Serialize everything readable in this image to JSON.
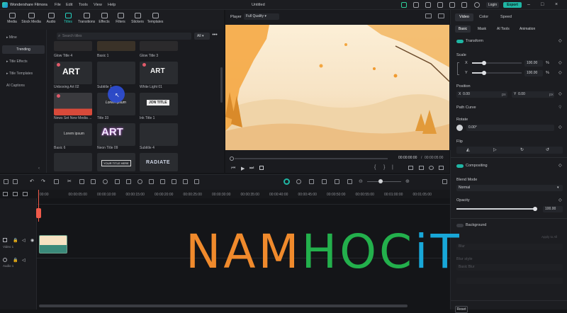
{
  "app": {
    "name": "Wondershare Filmora",
    "doc_title": "Untitled",
    "menu": [
      "File",
      "Edit",
      "Tools",
      "View",
      "Help"
    ],
    "login": "Login",
    "export": "Export"
  },
  "toolbar": {
    "tabs": [
      "Media",
      "Stock Media",
      "Audio",
      "Titles",
      "Transitions",
      "Effects",
      "Filters",
      "Stickers",
      "Templates"
    ],
    "active": "Titles"
  },
  "library": {
    "sidebar": [
      {
        "label": "Mine",
        "prefix": "▸"
      },
      {
        "label": "Trending",
        "prefix": ""
      },
      {
        "label": "Title Effects",
        "prefix": "▸"
      },
      {
        "label": "Title Templates",
        "prefix": "▸"
      },
      {
        "label": "AI Captions",
        "prefix": ""
      }
    ],
    "search_placeholder": "Search titles",
    "filter": "All",
    "more": "•••",
    "rows": [
      [
        "Glow Title 4",
        "Basic 1",
        "Glow Title 3"
      ],
      [
        "Unboxing Art 02",
        "Subtitle 1",
        "White Light 01"
      ],
      [
        "News Set New Media ...",
        "Title 33",
        "Ink Title 1"
      ],
      [
        "Basic 6",
        "Neon Title 09",
        "Subtitle 4"
      ],
      [
        "",
        "",
        ""
      ]
    ],
    "thumb_text": {
      "art1": "ART",
      "art2": "ART",
      "lorem": "Lorem ipsum",
      "jon": "JON TITLE",
      "lorem2": "Lorem ipsum",
      "neon": "ART",
      "yourtitle": "YOUR TITLE HERE",
      "radiate": "RADIATE"
    }
  },
  "player": {
    "label": "Player",
    "quality": "Full Quality",
    "time_current": "00:00:00:00",
    "time_total": "00:00:05:00",
    "separator": "/"
  },
  "inspector": {
    "tabs": [
      "Video",
      "Color",
      "Speed"
    ],
    "subtabs": [
      "Basic",
      "Mask",
      "AI Tools",
      "Animation"
    ],
    "transform": "Transform",
    "scale": "Scale",
    "x_label": "X",
    "y_label": "Y",
    "scale_x": "100.00",
    "scale_y": "100.00",
    "pct": "%",
    "position": "Position",
    "pos_x": "0.00",
    "pos_y": "0.00",
    "px": "px",
    "path_curve": "Path Curve",
    "rotate": "Rotate",
    "rotate_val": "0.00°",
    "flip": "Flip",
    "compositing": "Compositing",
    "blend_mode": "Blend Mode",
    "blend_val": "Normal",
    "opacity": "Opacity",
    "opacity_val": "100.00",
    "opacity_level": 1.0,
    "scale_level": 0.25,
    "background": "Background",
    "reset": "Reset",
    "apply_all": "Apply to All",
    "blur": "Blur",
    "blur_style": "Blur style",
    "basic_blur": "Basic Blur"
  },
  "timeline": {
    "ticks": [
      "00:00",
      "00:00:05:00",
      "00:00:10:00",
      "00:00:15:00",
      "00:00:20:00",
      "00:00:25:00",
      "00:00:30:00",
      "00:00:35:00",
      "00:00:40:00",
      "00:00:45:00",
      "00:00:50:00",
      "00:00:55:00",
      "00:01:00:00",
      "00:01:05:00"
    ],
    "video_track": "Video 1",
    "audio_track": "Audio 1"
  },
  "watermark": {
    "parts": [
      "NAM",
      "HOC",
      "iT"
    ],
    "colors": [
      "#f08a2c",
      "#23b04c",
      "#18a7d8"
    ]
  },
  "colors": {
    "accent": "#1fb6a4",
    "playhead": "#f05a4a"
  }
}
